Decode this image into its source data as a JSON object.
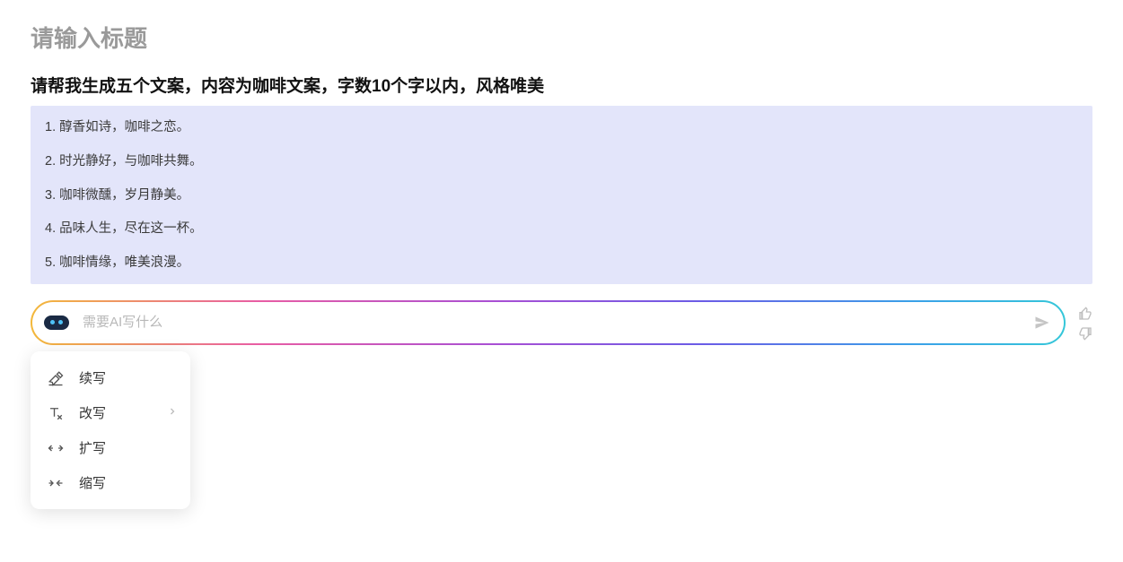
{
  "title_placeholder": "请输入标题",
  "prompt": "请帮我生成五个文案，内容为咖啡文案，字数10个字以内，风格唯美",
  "responses": [
    "1. 醇香如诗，咖啡之恋。",
    "2. 时光静好，与咖啡共舞。",
    "3. 咖啡微醺，岁月静美。",
    "4. 品味人生，尽在这一杯。",
    "5. 咖啡情缘，唯美浪漫。"
  ],
  "chat_placeholder": "需要AI写什么",
  "menu": {
    "items": [
      {
        "label": "续写",
        "has_sub": false
      },
      {
        "label": "改写",
        "has_sub": true
      },
      {
        "label": "扩写",
        "has_sub": false
      },
      {
        "label": "缩写",
        "has_sub": false
      }
    ]
  }
}
